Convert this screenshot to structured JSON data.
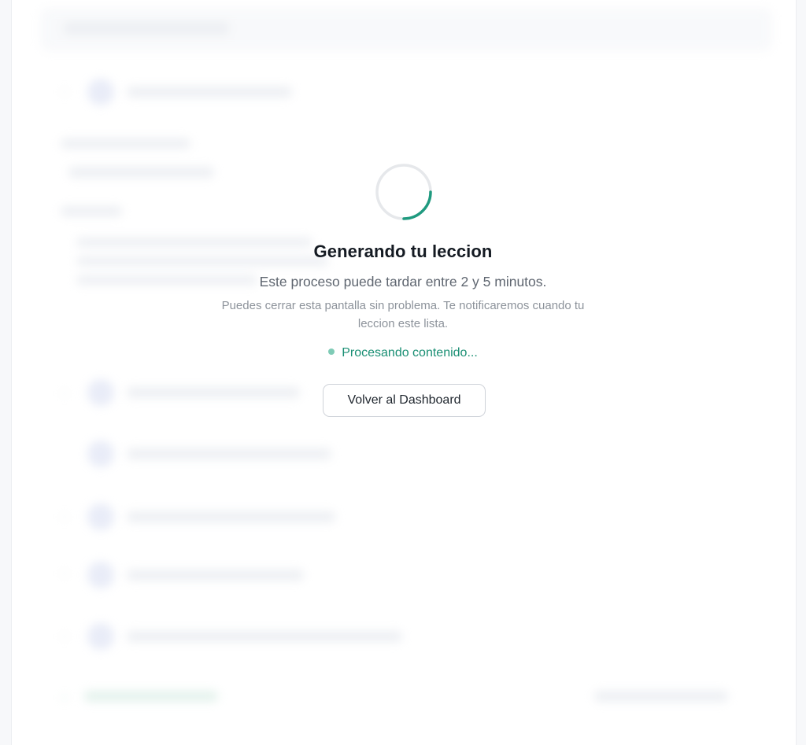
{
  "modal": {
    "title": "Generando tu leccion",
    "subtitle": "Este proceso puede tardar entre 2 y 5 minutos.",
    "note": "Puedes cerrar esta pantalla sin problema. Te notificaremos cuando tu leccion este lista.",
    "status": "Procesando contenido...",
    "button_label": "Volver al Dashboard"
  },
  "colors": {
    "accent": "#1a8f74",
    "spinner_track": "#e6e8eb",
    "spinner_arc": "#1f9a7f",
    "title": "#141a22",
    "muted": "#8d939b"
  },
  "icons": {
    "spinner": "loading-spinner-icon",
    "status": "status-dot-icon"
  }
}
